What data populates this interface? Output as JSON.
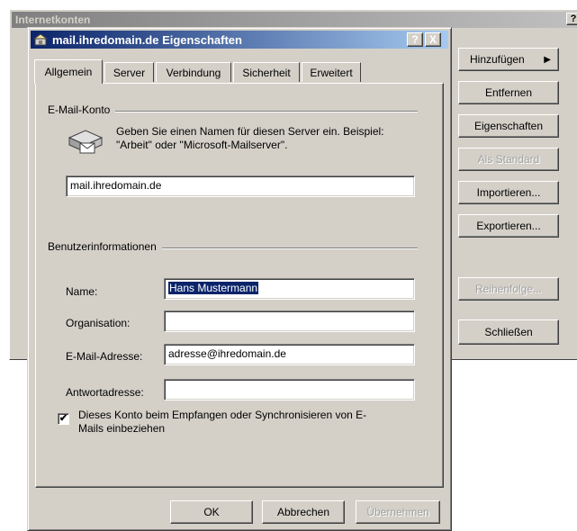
{
  "background_window": {
    "title": "Internetkonten",
    "help_glyph": "?",
    "close_glyph": "x",
    "buttons": {
      "add": "Hinzufügen",
      "add_arrow": "▶",
      "remove": "Entfernen",
      "properties": "Eigenschaften",
      "set_default": "Als Standard",
      "import": "Importieren...",
      "export": "Exportieren...",
      "order": "Reihenfolge...",
      "close": "Schließen"
    }
  },
  "dialog": {
    "title": "mail.ihredomain.de Eigenschaften",
    "help_glyph": "?",
    "close_glyph": "X",
    "tabs": [
      {
        "label": "Allgemein",
        "active": true
      },
      {
        "label": "Server"
      },
      {
        "label": "Verbindung"
      },
      {
        "label": "Sicherheit"
      },
      {
        "label": "Erweitert"
      }
    ],
    "email_account": {
      "heading": "E-Mail-Konto",
      "description": "Geben Sie einen Namen für diesen Server ein. Beispiel: \"Arbeit\" oder \"Microsoft-Mailserver\".",
      "account_name": "mail.ihredomain.de"
    },
    "user_info": {
      "heading": "Benutzerinformationen",
      "name_label": "Name:",
      "name_value": "Hans Mustermann",
      "org_label": "Organisation:",
      "org_value": "",
      "email_label": "E-Mail-Adresse:",
      "email_value": "adresse@ihredomain.de",
      "reply_label": "Antwortadresse:",
      "reply_value": ""
    },
    "include_checkbox": {
      "checked": true,
      "check_glyph": "✔",
      "label": "Dieses Konto beim Empfangen oder Synchronisieren von E-Mails einbeziehen"
    },
    "buttons": {
      "ok": "OK",
      "cancel": "Abbrechen",
      "apply": "Übernehmen"
    }
  }
}
